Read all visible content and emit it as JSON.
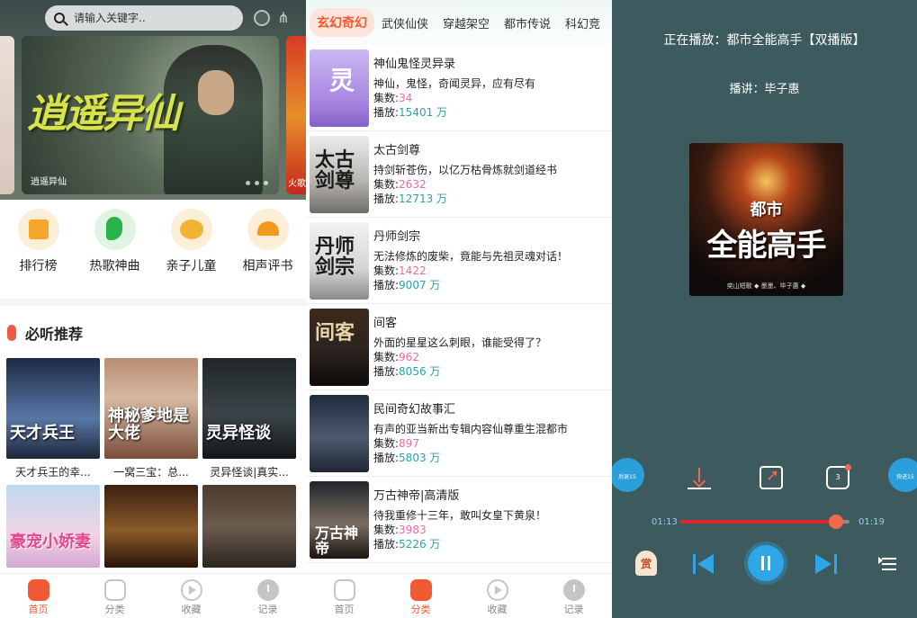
{
  "home": {
    "search_placeholder": "请输入关键字..",
    "banner": {
      "title": "逍遥异仙",
      "caption": "逍遥异仙",
      "side_label": "火歌"
    },
    "categories": [
      {
        "label": "排行榜",
        "icon": "trophy-icon"
      },
      {
        "label": "热歌神曲",
        "icon": "music-note-icon"
      },
      {
        "label": "亲子儿童",
        "icon": "kids-icon"
      },
      {
        "label": "相声评书",
        "icon": "fan-icon"
      }
    ],
    "section_title": "必听推荐",
    "books": [
      {
        "title": "天才兵王的幸...",
        "cover_text": "天才兵王"
      },
      {
        "title": "一窝三宝：总...",
        "cover_text": "神秘爹地是大佬"
      },
      {
        "title": "灵异怪谈|真实...",
        "cover_text": "灵异怪谈"
      },
      {
        "title": "",
        "cover_text": "豪宠小娇妻"
      },
      {
        "title": "",
        "cover_text": ""
      },
      {
        "title": "",
        "cover_text": ""
      }
    ],
    "tabs": [
      {
        "label": "首页",
        "active": true
      },
      {
        "label": "分类",
        "active": false
      },
      {
        "label": "收藏",
        "active": false
      },
      {
        "label": "记录",
        "active": false
      }
    ]
  },
  "category": {
    "tabs": [
      "玄幻奇幻",
      "武侠仙侠",
      "穿越架空",
      "都市传说",
      "科幻竞"
    ],
    "count_label": "集数:",
    "plays_label": "播放:",
    "items": [
      {
        "title": "神仙鬼怪灵异录",
        "desc": "神仙，鬼怪，奇闻灵异，应有尽有",
        "episodes": "34",
        "plays": "15401 万",
        "cover_text": "灵"
      },
      {
        "title": "太古剑尊",
        "desc": "持剑斩苍伤，以亿万枯骨炼就剑道经书",
        "episodes": "2632",
        "plays": "12713 万",
        "cover_text": "太古剑尊"
      },
      {
        "title": "丹师剑宗",
        "desc": "无法修炼的废柴，竟能与先祖灵魂对话！",
        "episodes": "1422",
        "plays": "9007 万",
        "cover_text": "丹师剑宗"
      },
      {
        "title": "间客",
        "desc": "外面的星星这么刺眼，谁能受得了？",
        "episodes": "962",
        "plays": "8056 万",
        "cover_text": "间客"
      },
      {
        "title": "民间奇幻故事汇",
        "desc": "有声的亚当新出专辑内容仙尊重生混都市",
        "episodes": "897",
        "plays": "5803 万",
        "cover_text": ""
      },
      {
        "title": "万古神帝|高清版",
        "desc": "待我重修十三年，敢叫女皇下黄泉！",
        "episodes": "3983",
        "plays": "5226 万",
        "cover_text": "万古神帝"
      }
    ],
    "bottom_tabs": [
      {
        "label": "首页",
        "active": false
      },
      {
        "label": "分类",
        "active": true
      },
      {
        "label": "收藏",
        "active": false
      },
      {
        "label": "记录",
        "active": false
      }
    ]
  },
  "player": {
    "now_playing": "正在播放：都市全能高手【双播版】",
    "narrator": "播讲：毕子惠",
    "cover": {
      "series": "都市",
      "title": "全能高手",
      "footer": "奕山短歌 ◆ 墨墨、毕子惠 ◆"
    },
    "rewind_label": "后退15",
    "forward_label": "快进15",
    "timer_value": "3",
    "time_current": "01:13",
    "time_total": "01:19",
    "progress": 0.92,
    "reward_label": "赏",
    "colors": {
      "accent": "#2ea6e8",
      "progress": "#e0242c",
      "bg": "#3d5b5f"
    }
  }
}
